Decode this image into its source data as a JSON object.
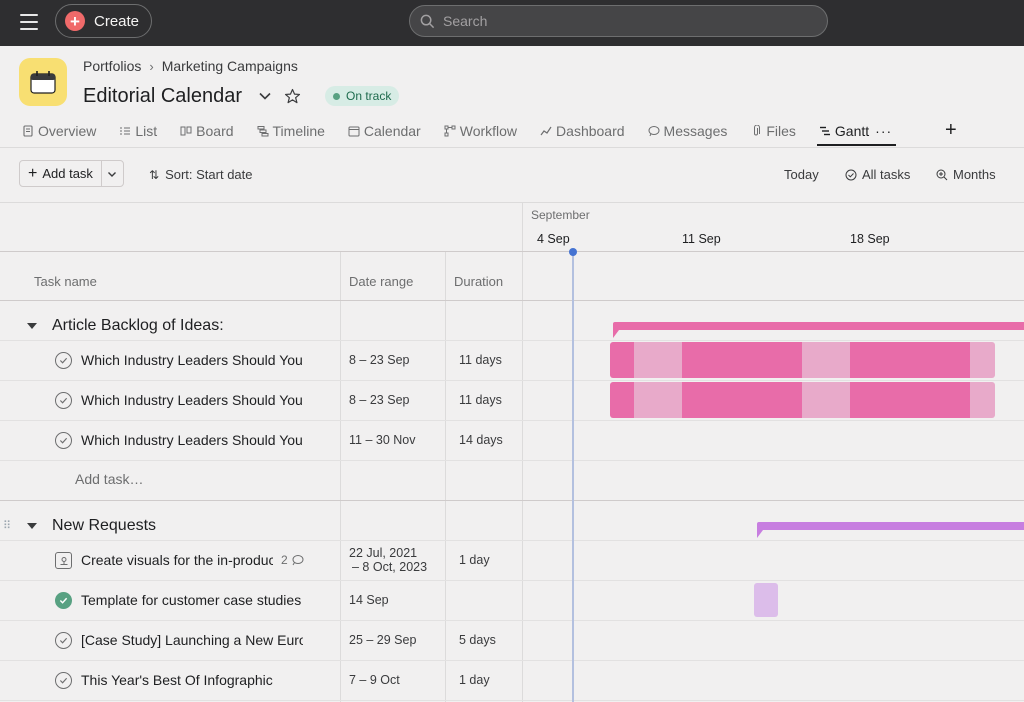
{
  "topbar": {
    "create_label": "Create",
    "search_placeholder": "Search"
  },
  "header": {
    "breadcrumb": [
      "Portfolios",
      "Marketing Campaigns"
    ],
    "title": "Editorial Calendar",
    "status": "On track"
  },
  "tabs": [
    {
      "label": "Overview",
      "icon": "document-icon"
    },
    {
      "label": "List",
      "icon": "list-icon"
    },
    {
      "label": "Board",
      "icon": "board-icon"
    },
    {
      "label": "Timeline",
      "icon": "timeline-icon"
    },
    {
      "label": "Calendar",
      "icon": "calendar-icon"
    },
    {
      "label": "Workflow",
      "icon": "workflow-icon"
    },
    {
      "label": "Dashboard",
      "icon": "dashboard-icon"
    },
    {
      "label": "Messages",
      "icon": "message-icon"
    },
    {
      "label": "Files",
      "icon": "paperclip-icon"
    },
    {
      "label": "Gantt",
      "icon": "gantt-icon",
      "active": true
    }
  ],
  "toolbar": {
    "add_task": "Add task",
    "sort": "Sort: Start date",
    "today": "Today",
    "all_tasks": "All tasks",
    "months": "Months"
  },
  "columns": {
    "task_name": "Task name",
    "date_range": "Date range",
    "duration": "Duration"
  },
  "timeline": {
    "month": "September",
    "days": [
      "4 Sep",
      "11 Sep",
      "18 Sep"
    ]
  },
  "sections": [
    {
      "title": "Article Backlog of Ideas:",
      "color": "#e86ca9",
      "tasks": [
        {
          "name": "Which Industry Leaders Should You Follow",
          "date": "8 – 23 Sep",
          "duration": "11 days",
          "status": "incomplete"
        },
        {
          "name": "Which Industry Leaders Should You Follow",
          "date": "8 – 23 Sep",
          "duration": "11 days",
          "status": "incomplete"
        },
        {
          "name": "Which Industry Leaders Should You Follow",
          "date": "11 – 30 Nov",
          "duration": "14 days",
          "status": "incomplete"
        }
      ],
      "add_task": "Add task…"
    },
    {
      "title": "New Requests",
      "color": "#c77ee0",
      "tasks": [
        {
          "name": "Create visuals for the in-product",
          "date_line1": "22 Jul, 2021",
          "date_line2": "– 8 Oct, 2023",
          "duration": "1 day",
          "comments": "2",
          "status": "milestone"
        },
        {
          "name": "Template for customer case studies",
          "date": "14 Sep",
          "duration": "",
          "status": "complete"
        },
        {
          "name": "[Case Study] Launching a New Europe",
          "date": "25 – 29 Sep",
          "duration": "5 days",
          "status": "incomplete"
        },
        {
          "name": "This Year's Best Of Infographic",
          "date": "7 – 9 Oct",
          "duration": "1 day",
          "status": "incomplete"
        }
      ]
    }
  ]
}
